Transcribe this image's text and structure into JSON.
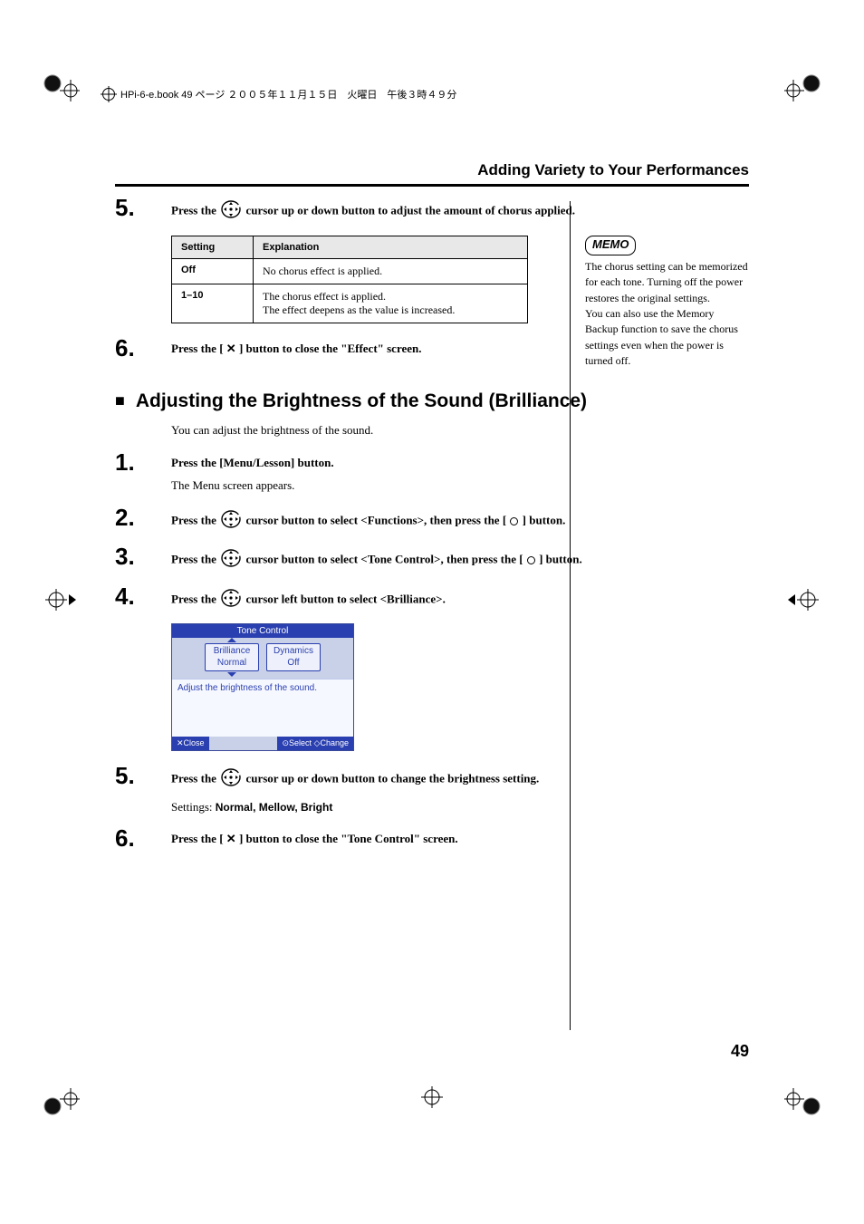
{
  "header_meta": "HPi-6-e.book  49 ページ  ２００５年１１月１５日　火曜日　午後３時４９分",
  "page_title": "Adding Variety to Your Performances",
  "page_number": "49",
  "memo": {
    "label": "MEMO",
    "text": "The chorus setting can be memorized for each tone. Turning off the power restores the original settings.\nYou can also use the Memory Backup function to save the chorus settings even when the power is turned off."
  },
  "chorus_table": {
    "headers": [
      "Setting",
      "Explanation"
    ],
    "rows": [
      {
        "setting": "Off",
        "explanation": "No chorus effect is applied."
      },
      {
        "setting": "1–10",
        "explanation": "The chorus effect is applied.\nThe effect deepens as the value is increased."
      }
    ]
  },
  "steps_a": {
    "s5": {
      "num": "5.",
      "pre": "Press the ",
      "post": " cursor up or down button to adjust the amount of chorus applied."
    },
    "s6": {
      "num": "6.",
      "pre": "Press the [ ",
      "mid": " ] button to close the \"Effect\" screen.",
      "xsym": "✕"
    }
  },
  "section2": {
    "heading": "Adjusting the Brightness of the Sound (Brilliance)",
    "intro": "You can adjust the brightness of the sound.",
    "s1": {
      "num": "1.",
      "text": "Press the [Menu/Lesson] button.",
      "sub": "The Menu screen appears."
    },
    "s2": {
      "num": "2.",
      "pre": "Press the ",
      "mid": " cursor button to select <Functions>, then press the [ ",
      "post": " ] button."
    },
    "s3": {
      "num": "3.",
      "pre": "Press the ",
      "mid": " cursor button to select <Tone Control>, then press the [ ",
      "post": " ] button."
    },
    "s4": {
      "num": "4.",
      "pre": "Press the ",
      "post": " cursor left button to select <Brilliance>."
    },
    "s5": {
      "num": "5.",
      "pre": "Press the ",
      "post": " cursor up or down button to change the brightness setting.",
      "settings_label": "Settings: ",
      "settings_value": "Normal, Mellow, Bright"
    },
    "s6": {
      "num": "6.",
      "pre": "Press the [ ",
      "post": " ] button to close the \"Tone Control\" screen.",
      "xsym": "✕"
    }
  },
  "screenshot": {
    "title": "Tone Control",
    "tab1": {
      "line1": "Brilliance",
      "line2": "Normal"
    },
    "tab2": {
      "line1": "Dynamics",
      "line2": "Off"
    },
    "desc": "Adjust the brightness of the sound.",
    "footer_left": "✕Close",
    "footer_right": "⊙Select  ◇Change"
  }
}
